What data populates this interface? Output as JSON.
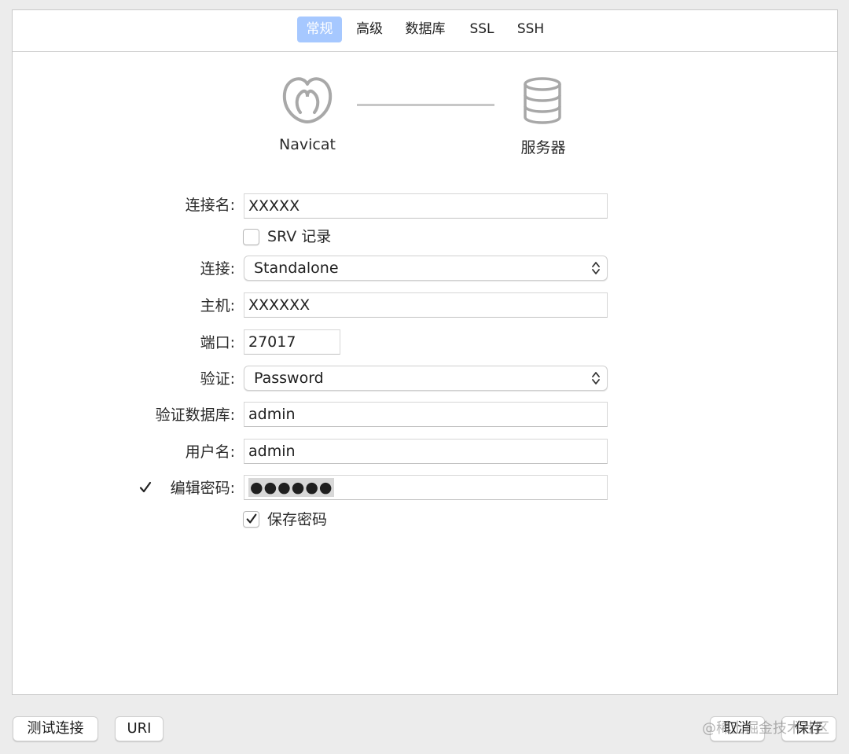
{
  "tabs": [
    {
      "label": "常规",
      "active": true
    },
    {
      "label": "高级",
      "active": false
    },
    {
      "label": "数据库",
      "active": false
    },
    {
      "label": "SSL",
      "active": false
    },
    {
      "label": "SSH",
      "active": false
    }
  ],
  "diagram": {
    "client_label": "Navicat",
    "server_label": "服务器",
    "client_icon": "navicat-logo-icon",
    "server_icon": "database-server-icon"
  },
  "form": {
    "connection_name": {
      "label": "连接名:",
      "value": "XXXXX"
    },
    "srv_record": {
      "label": "SRV 记录",
      "checked": false
    },
    "connection_type": {
      "label": "连接:",
      "value": "Standalone"
    },
    "host": {
      "label": "主机:",
      "value": "XXXXXX"
    },
    "port": {
      "label": "端口:",
      "value": "27017"
    },
    "auth": {
      "label": "验证:",
      "value": "Password"
    },
    "auth_database": {
      "label": "验证数据库:",
      "value": "admin"
    },
    "username": {
      "label": "用户名:",
      "value": "admin"
    },
    "edit_password": {
      "label": "编辑密码:",
      "checked": true,
      "value": "●●●●●●"
    },
    "save_password": {
      "label": "保存密码",
      "checked": true
    }
  },
  "footer": {
    "test_connection": "测试连接",
    "uri": "URI",
    "cancel": "取消",
    "save": "保存"
  },
  "watermark": "@稀土掘金技术社区",
  "colors": {
    "active_tab": "#a6c8ff",
    "background": "#ececec",
    "icon_gray": "#a8a8a8"
  }
}
